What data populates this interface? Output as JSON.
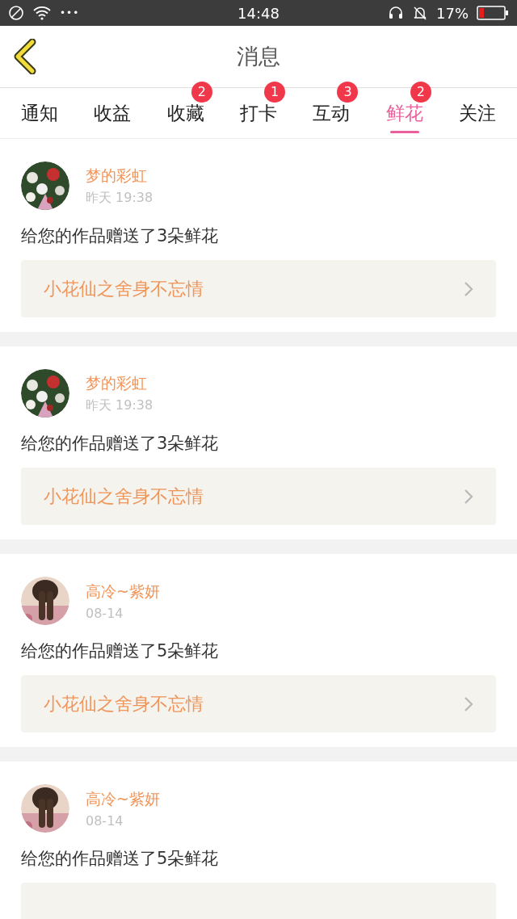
{
  "status_bar": {
    "time": "14:48",
    "battery_text": "17%",
    "menu_dots": "•••"
  },
  "header": {
    "title": "消息"
  },
  "tabs": [
    {
      "label": "通知",
      "selected": false
    },
    {
      "label": "收益",
      "selected": false
    },
    {
      "label": "收藏",
      "selected": false,
      "badge": "2"
    },
    {
      "label": "打卡",
      "selected": false,
      "badge": "1"
    },
    {
      "label": "互动",
      "selected": false,
      "badge": "3"
    },
    {
      "label": "鲜花",
      "selected": true,
      "badge": "2"
    },
    {
      "label": "关注",
      "selected": false
    }
  ],
  "messages": [
    {
      "name": "梦的彩虹",
      "time": "昨天 19:38",
      "text": "给您的作品赠送了3朵鲜花",
      "work": "小花仙之舍身不忘情"
    },
    {
      "name": "梦的彩虹",
      "time": "昨天 19:38",
      "text": "给您的作品赠送了3朵鲜花",
      "work": "小花仙之舍身不忘情"
    },
    {
      "name": "高冷~紫妍",
      "time": "08-14",
      "text": "给您的作品赠送了5朵鲜花",
      "work": "小花仙之舍身不忘情"
    },
    {
      "name": "高冷~紫妍",
      "time": "08-14",
      "text": "给您的作品赠送了5朵鲜花"
    }
  ]
}
